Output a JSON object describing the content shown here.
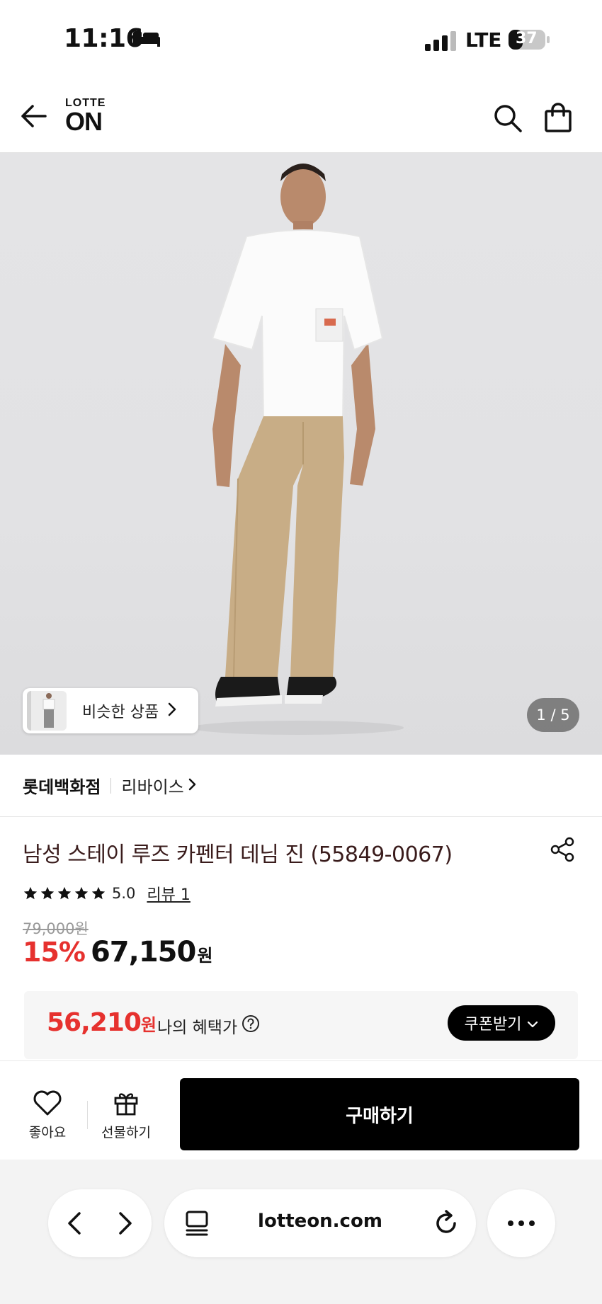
{
  "status_bar": {
    "time": "11:16",
    "network": "LTE",
    "battery": "37"
  },
  "header": {
    "logo_top": "LOTTE",
    "logo_main": "ON"
  },
  "hero": {
    "similar_label": "비슷한 상품",
    "page_indicator": "1 / 5"
  },
  "brand": {
    "store": "롯데백화점",
    "brand_name": "리바이스"
  },
  "product": {
    "title": "남성 스테이 루즈 카펜터 데님 진 (55849-0067)",
    "rating": "5.0",
    "rating_stars": 5,
    "review_link": "리뷰 1",
    "original_price": "79,000원",
    "discount": "15%",
    "sale_price": "67,150",
    "currency": "원"
  },
  "benefit": {
    "amount": "56,210",
    "currency": "원",
    "label": "나의 혜택가",
    "coupon_button": "쿠폰받기"
  },
  "action_bar": {
    "like_label": "좋아요",
    "gift_label": "선물하기",
    "buy_label": "구매하기"
  },
  "browser": {
    "url": "lotteon.com"
  },
  "colors": {
    "accent_red": "#e6312e",
    "title_text": "#3a1c1c",
    "primary_button": "#000000"
  }
}
